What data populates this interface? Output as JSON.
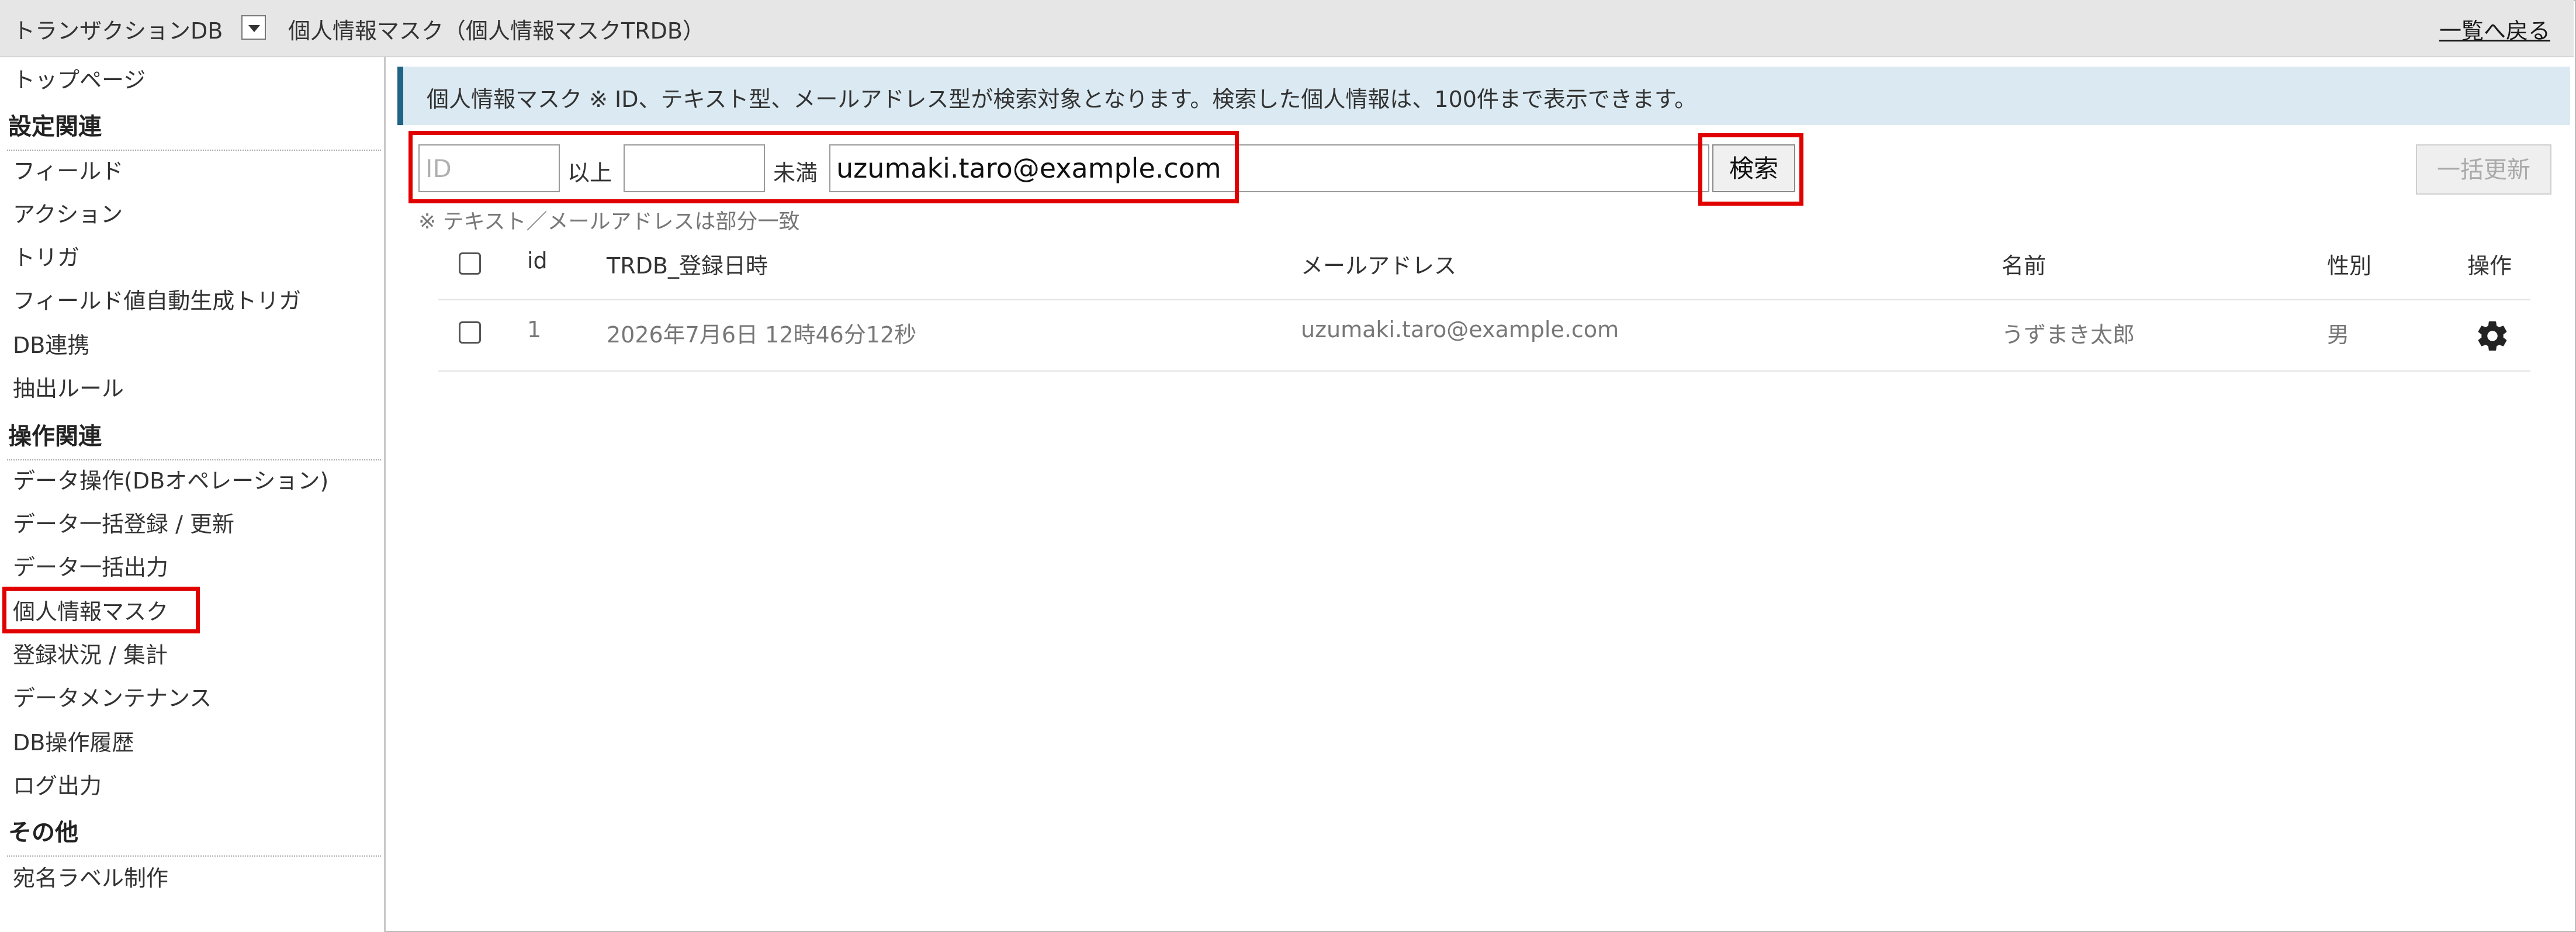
{
  "header": {
    "db_name": "トランザクションDB",
    "title": "個人情報マスク（個人情報マスクTRDB）",
    "back_link": "一覧へ戻る"
  },
  "sidebar": {
    "top": "トップページ",
    "sections": [
      {
        "heading": "設定関連",
        "items": [
          "フィールド",
          "アクション",
          "トリガ",
          "フィールド値自動生成トリガ",
          "DB連携",
          "抽出ルール"
        ]
      },
      {
        "heading": "操作関連",
        "items": [
          "データ操作(DBオペレーション)",
          "データ一括登録 / 更新",
          "データ一括出力",
          "個人情報マスク",
          "登録状況 / 集計",
          "データメンテナンス",
          "DB操作履歴",
          "ログ出力"
        ]
      },
      {
        "heading": "その他",
        "items": [
          "宛名ラベル制作"
        ]
      }
    ],
    "active_item": "個人情報マスク"
  },
  "notice": "個人情報マスク ※ ID、テキスト型、メールアドレス型が検索対象となります。検索した個人情報は、100件まで表示できます。",
  "search": {
    "id_placeholder": "ID",
    "id_from_value": "",
    "label_gte": "以上",
    "id_to_value": "",
    "label_lt": "未満",
    "email_value": "uzumaki.taro@example.com",
    "search_button": "検索",
    "bulk_update_button": "一括更新",
    "note": "※ テキスト／メールアドレスは部分一致"
  },
  "table": {
    "columns": [
      "id",
      "TRDB_登録日時",
      "メールアドレス",
      "名前",
      "性別",
      "操作"
    ],
    "rows": [
      {
        "id": "1",
        "registered": "2026年7月6日 12時46分12秒",
        "email": "uzumaki.taro@example.com",
        "name": "うずまき太郎",
        "gender": "男",
        "action_icon": "gear-icon"
      }
    ]
  },
  "colors": {
    "highlight": "#e00000",
    "notice_bg": "#dbeaf2",
    "notice_accent": "#1f6386",
    "header_bg": "#e6e6e6"
  }
}
